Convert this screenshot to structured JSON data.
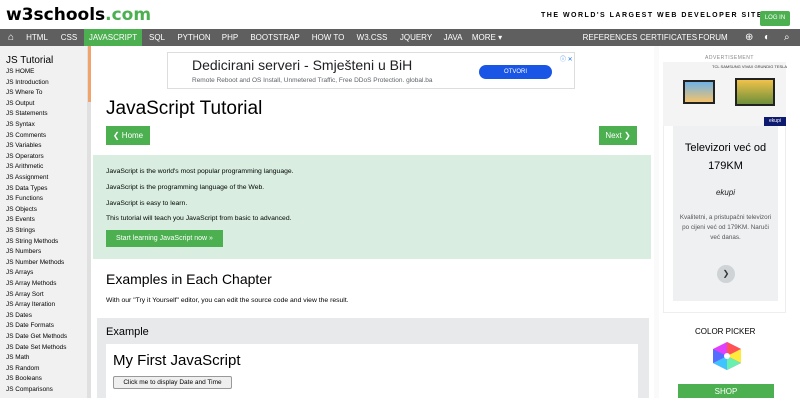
{
  "topbar": {
    "logo_main": "w3schools",
    "logo_suffix": ".com",
    "tagline": "THE WORLD'S LARGEST WEB DEVELOPER SITE",
    "login": "LOG IN"
  },
  "nav": {
    "items": [
      "HTML",
      "CSS",
      "JAVASCRIPT",
      "SQL",
      "PYTHON",
      "PHP",
      "BOOTSTRAP",
      "HOW TO",
      "W3.CSS",
      "JQUERY",
      "JAVA",
      "MORE ▾"
    ],
    "active": "JAVASCRIPT",
    "right_items": [
      "REFERENCES ▾",
      "CERTIFICATES",
      "FORUM"
    ],
    "icons": [
      "globe-icon",
      "theme-icon",
      "search-icon"
    ]
  },
  "sidebar": {
    "title": "JS Tutorial",
    "links": [
      "JS HOME",
      "JS Introduction",
      "JS Where To",
      "JS Output",
      "JS Statements",
      "JS Syntax",
      "JS Comments",
      "JS Variables",
      "JS Operators",
      "JS Arithmetic",
      "JS Assignment",
      "JS Data Types",
      "JS Functions",
      "JS Objects",
      "JS Events",
      "JS Strings",
      "JS String Methods",
      "JS Numbers",
      "JS Number Methods",
      "JS Arrays",
      "JS Array Methods",
      "JS Array Sort",
      "JS Array Iteration",
      "JS Dates",
      "JS Date Formats",
      "JS Date Get Methods",
      "JS Date Set Methods",
      "JS Math",
      "JS Random",
      "JS Booleans",
      "JS Comparisons"
    ]
  },
  "ad": {
    "title": "Dedicirani serveri - Smješteni u BiH",
    "subtitle": "Remote Reboot and OS Install, Unmetered Traffic, Free DDoS Protection. global.ba",
    "button": "OTVORI",
    "marks": "ⓘ ✕"
  },
  "main": {
    "title": "JavaScript Tutorial",
    "home_button": "❮ Home",
    "next_button": "Next ❯",
    "intro": [
      "JavaScript is the world's most popular programming language.",
      "JavaScript is the programming language of the Web.",
      "JavaScript is easy to learn.",
      "This tutorial will teach you JavaScript from basic to advanced."
    ],
    "start_button": "Start learning JavaScript now »",
    "examples_heading": "Examples in Each Chapter",
    "examples_desc": "With our \"Try it Yourself\" editor, you can edit the source code and view the result.",
    "example_label": "Example",
    "example_heading": "My First JavaScript",
    "example_button": "Click me to display Date and Time"
  },
  "right": {
    "adv_label": "ADVERTISEMENT",
    "ad_brands": "TCL  SAMSUNG  VIVAX  GRUNDIG  TESLA",
    "ad_badge": "ekupi",
    "ad_heading": "Televizori već od 179KM",
    "ad_logo": "ekupi",
    "ad_text": "Kvalitetni, a pristupačni televizori po cijeni već od 179KM. Naruči već danas.",
    "ad_arrow": "❯",
    "color_picker": "COLOR PICKER",
    "shop": "SHOP"
  }
}
